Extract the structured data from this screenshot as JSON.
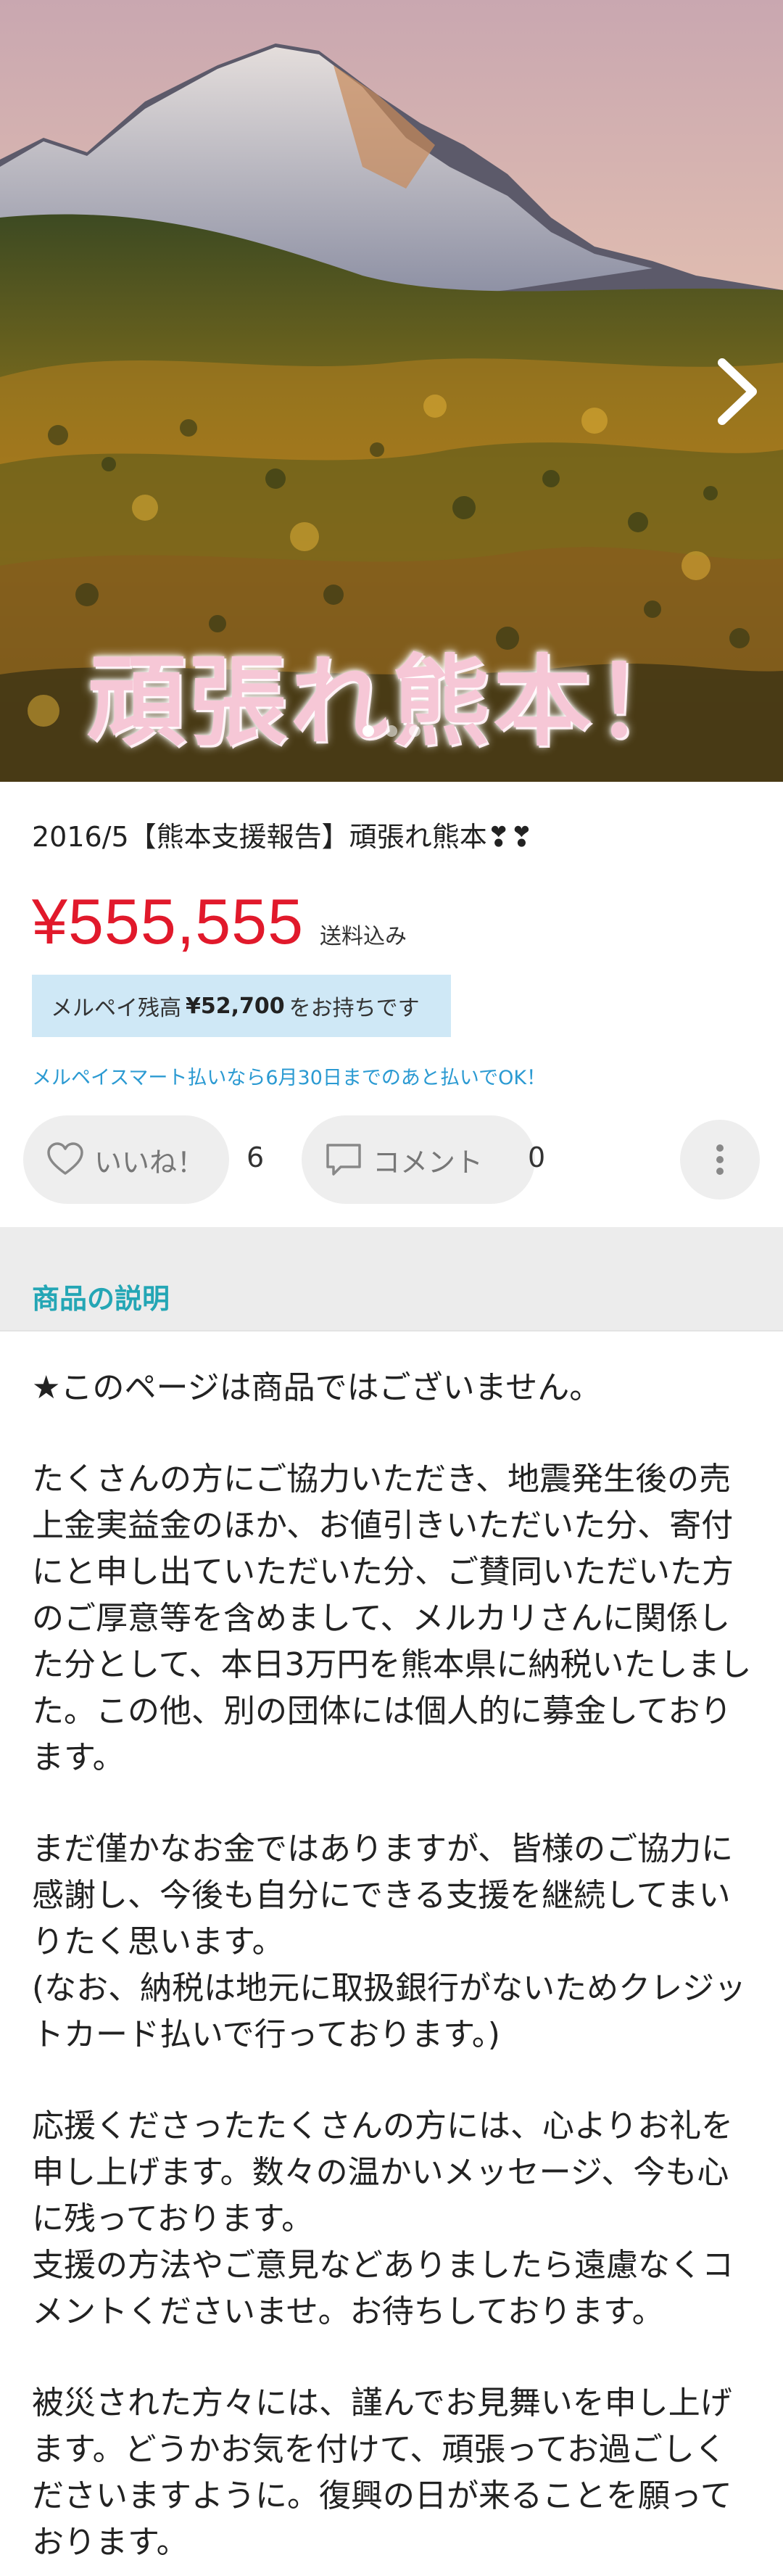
{
  "hero": {
    "caption": "頑張れ熊本！",
    "dots": 3,
    "active_dot": 0,
    "icons": {
      "next": "chevron-right-icon"
    }
  },
  "product": {
    "title": "2016/5【熊本支援報告】頑張れ熊本❣❣",
    "price": "¥555,555",
    "shipping": "送料込み",
    "balance_prefix": "メルペイ残高",
    "balance_amount": "¥52,700",
    "balance_suffix": "をお持ちです",
    "smartpay_note": "メルペイスマート払いなら6月30日までのあと払いでOK！"
  },
  "actions": {
    "like_label": "いいね！",
    "like_count": "6",
    "comment_label": "コメント",
    "comment_count": "0",
    "icons": {
      "like": "heart-icon",
      "comment": "comment-icon",
      "more": "more-vertical-icon"
    }
  },
  "description": {
    "heading": "商品の説明",
    "paragraphs": [
      "★このページは商品ではございません。",
      "たくさんの方にご協力いただき、地震発生後の売上金実益金のほか、お値引きいただいた分、寄付にと申し出ていただいた分、ご賛同いただいた方のご厚意等を含めまして、メルカリさんに関係した分として、本日3万円を熊本県に納税いたしました。この他、別の団体には個人的に募金しております。",
      "まだ僅かなお金ではありますが、皆様のご協力に感謝し、今後も自分にできる支援を継続してまいりたく思います。\n(なお、納税は地元に取扱銀行がないためクレジットカード払いで行っております。)",
      "応援くださったたくさんの方には、心よりお礼を申し上げます。数々の温かいメッセージ、今も心に残っております。\n支援の方法やご意見などありましたら遠慮なくコメントくださいませ。お待ちしております。",
      "被災された方々には、謹んでお見舞いを申し上げます。どうかお気を付けて、頑張ってお過ごしくださいますように。復興の日が来ることを願っております。"
    ]
  },
  "colors": {
    "price": "#e1192b",
    "accent_teal": "#24a6b5",
    "link_blue": "#2b9ad2",
    "balance_bg": "#cfe8f6"
  }
}
